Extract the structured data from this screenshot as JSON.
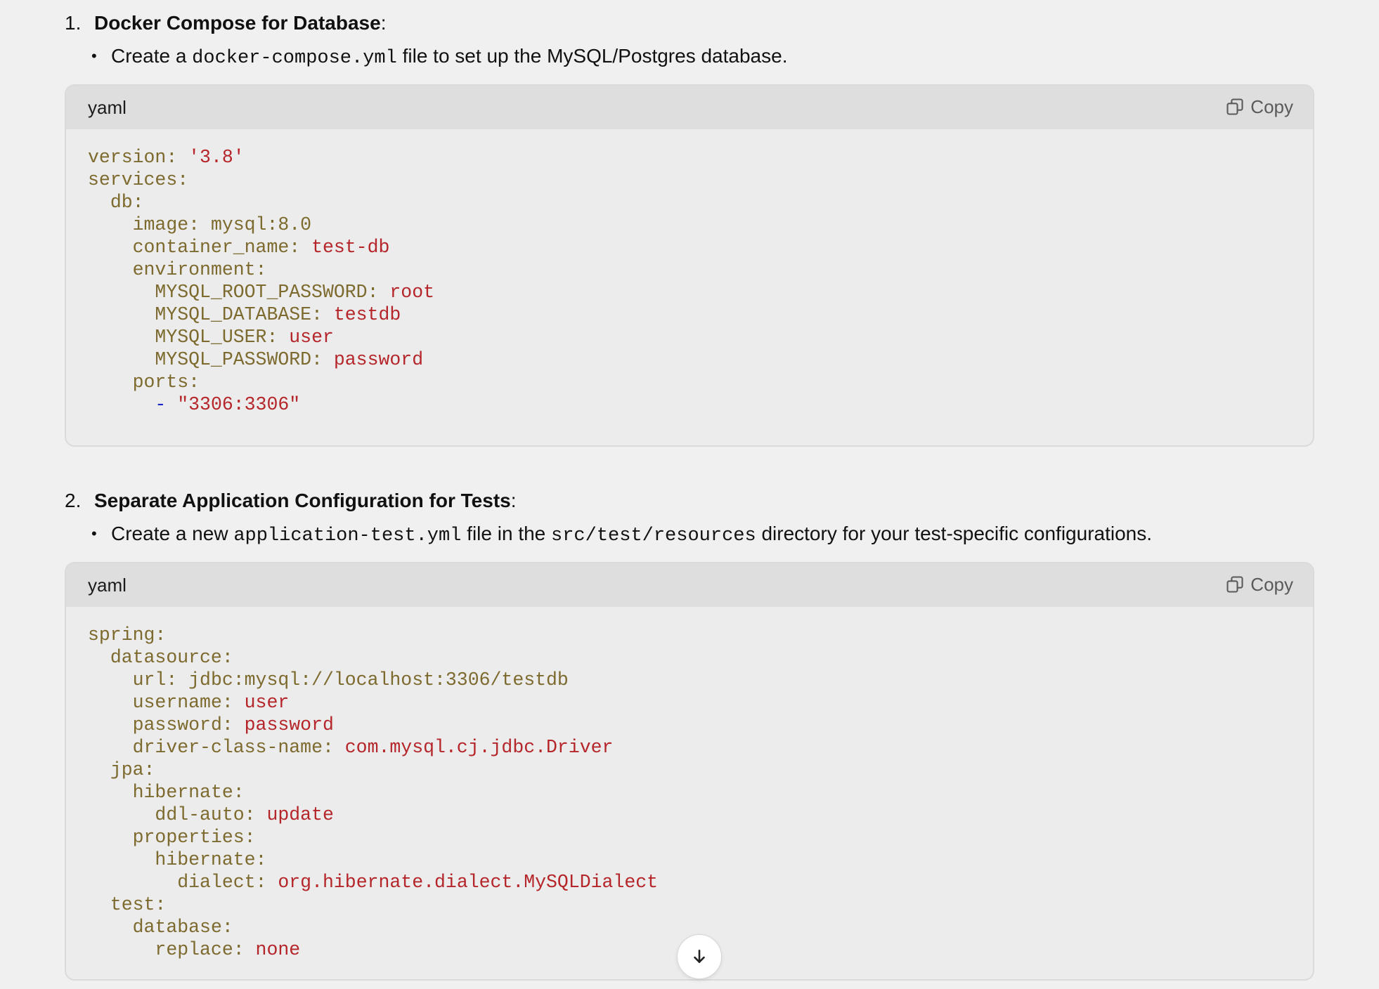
{
  "sections": [
    {
      "number": "1.",
      "title": "Docker Compose for Database",
      "title_suffix": ":",
      "bullet": {
        "before": "Create a ",
        "code": "docker-compose.yml",
        "after": " file to set up the MySQL/Postgres database."
      },
      "code_block": {
        "language": "yaml",
        "copy_label": "Copy",
        "lines": [
          {
            "indent": "",
            "key": "version:",
            "value": " '3.8'"
          },
          {
            "indent": "",
            "key": "services:",
            "value": ""
          },
          {
            "indent": "  ",
            "key": "db:",
            "value": ""
          },
          {
            "indent": "    ",
            "key": "image: mysql:8.0",
            "value": ""
          },
          {
            "indent": "    ",
            "key": "container_name:",
            "value": " test-db"
          },
          {
            "indent": "    ",
            "key": "environment:",
            "value": ""
          },
          {
            "indent": "      ",
            "key": "MYSQL_ROOT_PASSWORD:",
            "value": " root"
          },
          {
            "indent": "      ",
            "key": "MYSQL_DATABASE:",
            "value": " testdb"
          },
          {
            "indent": "      ",
            "key": "MYSQL_USER:",
            "value": " user"
          },
          {
            "indent": "      ",
            "key": "MYSQL_PASSWORD:",
            "value": " password"
          },
          {
            "indent": "    ",
            "key": "ports:",
            "value": ""
          },
          {
            "indent": "      ",
            "punct": "-",
            "key": "",
            "value": " \"3306:3306\""
          }
        ]
      }
    },
    {
      "number": "2.",
      "title": "Separate Application Configuration for Tests",
      "title_suffix": ":",
      "bullet": {
        "before": "Create a new ",
        "code": "application-test.yml",
        "middle": " file in the ",
        "code2": "src/test/resources",
        "after": " directory for your test-specific configurations."
      },
      "code_block": {
        "language": "yaml",
        "copy_label": "Copy",
        "lines": [
          {
            "indent": "",
            "key": "spring:",
            "value": ""
          },
          {
            "indent": "  ",
            "key": "datasource:",
            "value": ""
          },
          {
            "indent": "    ",
            "key": "url: jdbc:mysql://localhost:3306/testdb",
            "value": ""
          },
          {
            "indent": "    ",
            "key": "username:",
            "value": " user"
          },
          {
            "indent": "    ",
            "key": "password:",
            "value": " password"
          },
          {
            "indent": "    ",
            "key": "driver-class-name:",
            "value": " com.mysql.cj.jdbc.Driver"
          },
          {
            "indent": "  ",
            "key": "jpa:",
            "value": ""
          },
          {
            "indent": "    ",
            "key": "hibernate:",
            "value": ""
          },
          {
            "indent": "      ",
            "key": "ddl-auto:",
            "value": " update"
          },
          {
            "indent": "    ",
            "key": "properties:",
            "value": ""
          },
          {
            "indent": "      ",
            "key": "hibernate:",
            "value": ""
          },
          {
            "indent": "        ",
            "key": "dialect:",
            "value": " org.hibernate.dialect.MySQLDialect"
          },
          {
            "indent": "  ",
            "key": "test:",
            "value": ""
          },
          {
            "indent": "    ",
            "key": "database:",
            "value": ""
          },
          {
            "indent": "      ",
            "key": "replace:",
            "value": " none"
          }
        ]
      }
    }
  ],
  "scroll_button": {
    "icon": "arrow-down-icon"
  },
  "colors": {
    "key": "#7d6a2e",
    "value": "#b5262a",
    "punct": "#1a24c8",
    "background": "#f0f0f0",
    "code_bg": "#ececec",
    "code_header_bg": "#dedede"
  }
}
